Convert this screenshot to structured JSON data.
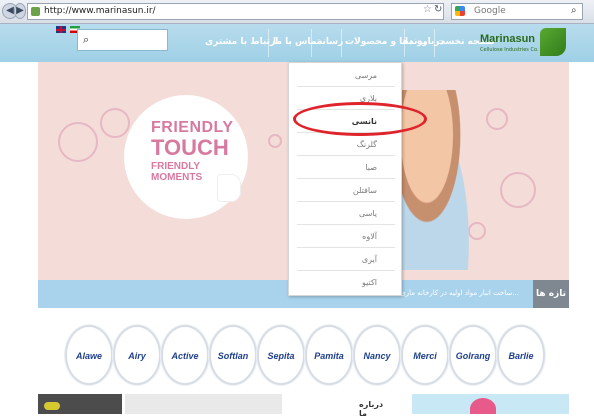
{
  "browser": {
    "url": "http://www.marinasun.ir/",
    "search_engine": "Google",
    "back_glyph": "◀",
    "forward_glyph": "▶",
    "star_glyph": "☆",
    "reload_glyph": "↻",
    "search_glyph": "⌕"
  },
  "header": {
    "search_glyph": "⌕",
    "nav": {
      "home": "صفحه نخست",
      "about": "درباره ما",
      "brands": "برندها و محصولات",
      "news": "رسانه",
      "contact": "تماس با ما",
      "customer": "ارتباط با مشتری"
    },
    "logo": {
      "name": "Marinasun",
      "subtitle": "Cellulose Industries Co."
    }
  },
  "dropdown": {
    "items": [
      "مرسی",
      "بلاری",
      "نانسی",
      "گلرنگ",
      "صبا",
      "سافتلن",
      "یاسی",
      "آلاوه",
      "آیری",
      "اکتیو"
    ],
    "selected_index": 2
  },
  "hero": {
    "line1": "FRIENDLY",
    "line2": "TOUCH",
    "line3": "FRIENDLY",
    "line4": "MOMENTS"
  },
  "newsbar": {
    "label": "تازه ها",
    "text": "ساخت انبار مواد اولیه در کارخانه ماری..."
  },
  "brands": [
    "Alawe",
    "Airy",
    "Active",
    "Softlan",
    "Sepita",
    "Pamita",
    "Nancy",
    "Merci",
    "Golrang",
    "Barlie"
  ],
  "footer": {
    "about": "درباره ما"
  },
  "colors": {
    "header": "#a9d6ec",
    "accent_red": "#e0242b",
    "logo_green": "#2b6a1c"
  }
}
